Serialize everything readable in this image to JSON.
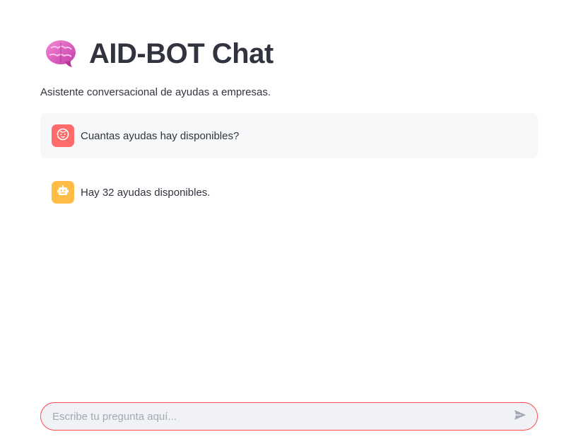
{
  "header": {
    "title": "AID-BOT Chat",
    "subtitle": "Asistente conversacional de ayudas a empresas.",
    "title_icon": "brain-icon"
  },
  "messages": [
    {
      "role": "user",
      "avatar_icon": "user-face-icon",
      "avatar_color": "#ff6b6b",
      "text": "Cuantas ayudas hay disponibles?"
    },
    {
      "role": "assistant",
      "avatar_icon": "robot-icon",
      "avatar_color": "#ffbd45",
      "text": "Hay 32 ayudas disponibles."
    }
  ],
  "chat_input": {
    "placeholder": "Escribe tu pregunta aquí...",
    "value": "",
    "send_icon": "send-icon"
  },
  "colors": {
    "accent": "#ff4b4b",
    "text": "#31333f",
    "user_bubble_bg": "#f7f8fa",
    "input_bg": "#f0f2f6"
  }
}
